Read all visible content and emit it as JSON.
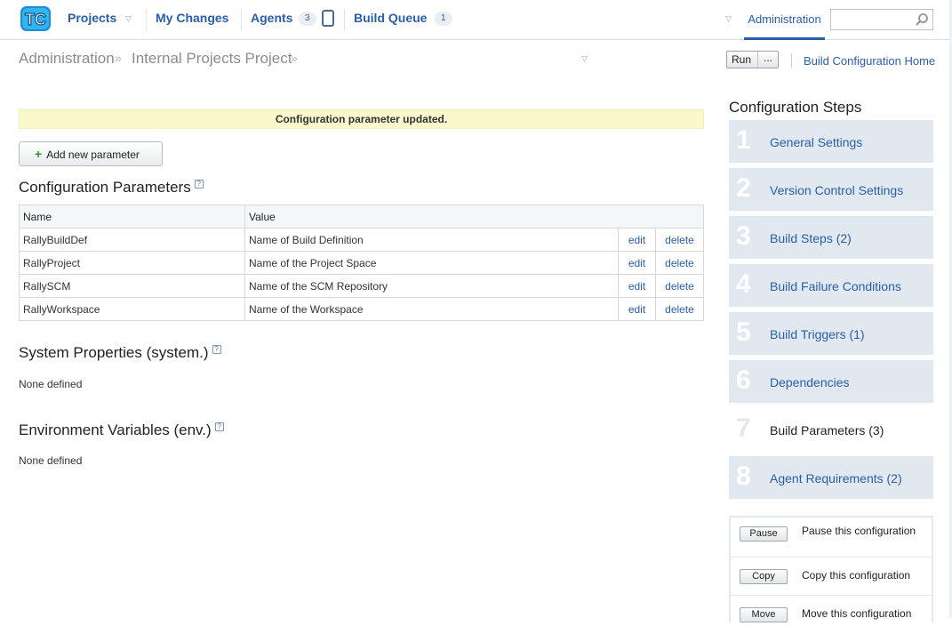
{
  "nav": {
    "logo_text": "TC",
    "projects": "Projects",
    "my_changes": "My Changes",
    "agents": "Agents",
    "agents_count": "3",
    "build_queue": "Build Queue",
    "build_queue_count": "1",
    "administration": "Administration",
    "search_placeholder": ""
  },
  "breadcrumb": {
    "items": [
      "Administration",
      "Internal Projects Project"
    ],
    "run_label": "Run",
    "run_more": "...",
    "home_link": "Build Configuration Home"
  },
  "main": {
    "message": "Configuration parameter updated.",
    "add_button": "Add new parameter",
    "config_title": "Configuration Parameters",
    "columns": [
      "Name",
      "Value"
    ],
    "rows": [
      {
        "name": "RallyBuildDef",
        "value": "Name of Build Definition",
        "edit": "edit",
        "delete": "delete"
      },
      {
        "name": "RallyProject",
        "value": "Name of the Project Space",
        "edit": "edit",
        "delete": "delete"
      },
      {
        "name": "RallySCM",
        "value": "Name of the SCM Repository",
        "edit": "edit",
        "delete": "delete"
      },
      {
        "name": "RallyWorkspace",
        "value": "Name of the Workspace",
        "edit": "edit",
        "delete": "delete"
      }
    ],
    "system_title": "System Properties (system.)",
    "system_empty": "None defined",
    "env_title": "Environment Variables (env.)",
    "env_empty": "None defined"
  },
  "sidebar": {
    "title": "Configuration Steps",
    "steps": [
      {
        "num": "1",
        "label": "General Settings"
      },
      {
        "num": "2",
        "label": "Version Control Settings"
      },
      {
        "num": "3",
        "label": "Build Steps (2)"
      },
      {
        "num": "4",
        "label": "Build Failure Conditions"
      },
      {
        "num": "5",
        "label": "Build Triggers (1)"
      },
      {
        "num": "6",
        "label": "Dependencies"
      },
      {
        "num": "7",
        "label": "Build Parameters (3)"
      },
      {
        "num": "8",
        "label": "Agent Requirements (2)"
      }
    ],
    "current_step": "7",
    "actions": [
      {
        "button": "Pause",
        "text": "Pause this configuration"
      },
      {
        "button": "Copy",
        "text": "Copy this configuration"
      },
      {
        "button": "Move",
        "text": "Move this configuration"
      }
    ]
  },
  "colors": {
    "link": "#2a5ea8",
    "message_bg": "#fbf8cc",
    "step_bg": "#e2e8ef"
  }
}
